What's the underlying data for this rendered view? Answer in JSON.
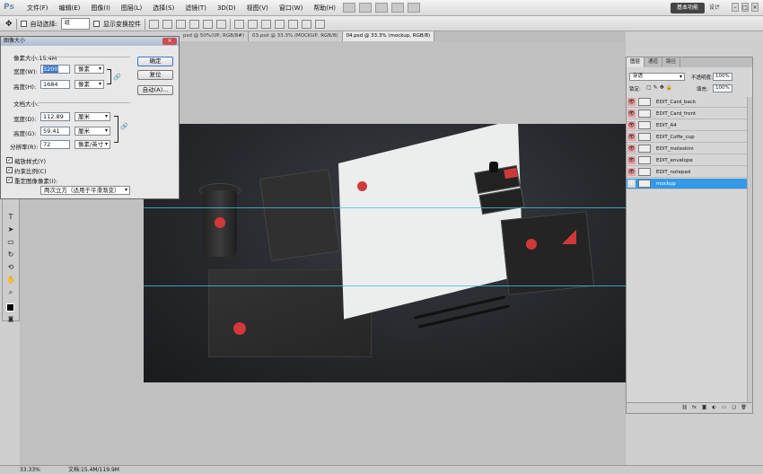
{
  "app": {
    "logo": "Ps"
  },
  "menu": [
    "文件(F)",
    "编辑(E)",
    "图像(I)",
    "图层(L)",
    "选择(S)",
    "滤镜(T)",
    "3D(D)",
    "视图(V)",
    "窗口(W)",
    "帮助(H)"
  ],
  "menu_icons": [
    "bridge-icon",
    "minibridge-icon",
    "zoom-level-icon",
    "arrange-icon",
    "screen-mode-icon"
  ],
  "workspace": {
    "active": "基本功能",
    "other": "设计"
  },
  "options_bar": {
    "auto_select_label": "自动选择:",
    "auto_select_value": "组",
    "show_transform_label": "显示变换控件"
  },
  "doc_tabs": [
    "psd @ 50%(UP, RGB/8#)",
    "03.psd @ 33.3% (MOCKUP, RGB/8)",
    "04.psd @ 33.3% (mockup, RGB/8)"
  ],
  "dialog": {
    "title": "图像大小",
    "pixel_size": "像素大小:15.4M",
    "width_label": "宽度(W):",
    "width_value": "3200",
    "height_label": "高度(H):",
    "height_value": "1684",
    "pixel_unit": "像素",
    "doc_size": "文档大小:",
    "doc_width_label": "宽度(D):",
    "doc_width_value": "112.89",
    "doc_height_label": "高度(G):",
    "doc_height_value": "59.41",
    "cm_unit": "厘米",
    "resolution_label": "分辨率(R):",
    "resolution_value": "72",
    "resolution_unit": "像素/英寸",
    "scale_styles": "缩放样式(Y)",
    "constrain": "约束比例(C)",
    "resample": "重定图像像素(I):",
    "resample_method": "两次立方（适用于平滑渐变）",
    "ok": "确定",
    "reset": "复位",
    "auto": "自动(A)..."
  },
  "layers_panel": {
    "tabs": [
      "图层",
      "通道",
      "路径"
    ],
    "blend_mode": "穿透",
    "opacity_label": "不透明度:",
    "opacity_value": "100%",
    "lock_label": "锁定:",
    "fill_label": "填充:",
    "fill_value": "100%",
    "layers": [
      {
        "name": "EDIT_Card_back",
        "selected": false
      },
      {
        "name": "EDIT_Card_front",
        "selected": false
      },
      {
        "name": "EDIT_A4",
        "selected": false
      },
      {
        "name": "EDIT_Coffe_cup",
        "selected": false
      },
      {
        "name": "EDIT_moleskini",
        "selected": false
      },
      {
        "name": "EDIT_envelope",
        "selected": false
      },
      {
        "name": "EDIT_notepad",
        "selected": false
      },
      {
        "name": "mockup",
        "selected": true
      }
    ],
    "footer_icons": [
      "link-icon",
      "fx-icon",
      "mask-icon",
      "adjustment-icon",
      "group-icon",
      "new-layer-icon",
      "trash-icon"
    ]
  },
  "status": {
    "zoom": "33.33%",
    "doc": "文档:15.4M/119.9M"
  },
  "colors": {
    "accent_red": "#d0393a",
    "selection_blue": "#3399e6",
    "guide": "#38c7d8"
  }
}
